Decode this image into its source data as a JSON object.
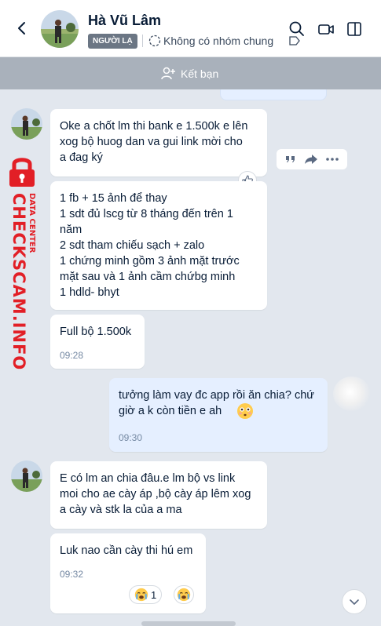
{
  "header": {
    "name": "Hà Vũ Lâm",
    "badge": "NGƯỜI LẠ",
    "group_status": "Không có nhóm chung"
  },
  "friend_bar": {
    "label": "Kết bạn"
  },
  "watermark": {
    "main": "CHECKSCAM.INFO",
    "sub": "DATA CENTER"
  },
  "messages": [
    {
      "text": "Oke a chốt lm thi bank e 1.500k e lên\nxog bộ huog dan va gui link mời cho\na đag ký"
    },
    {
      "text": "1 fb + 15 ảnh để thay\n1  sdt  đủ lscg  từ 8 tháng đến trên 1\nnăm\n2 sdt tham chiếu sạch + zalo\n1 chứng minh gồm 3 ảnh  mặt trước\nmặt sau và 1 ảnh cầm chứbg minh\n1 hdld- bhyt"
    },
    {
      "text": "Full bộ 1.500k",
      "time": "09:28"
    },
    {
      "text": "tưởng làm vay đc app rồi ăn chia? chứ\ngiờ a k còn tiền e ah",
      "time": "09:30"
    },
    {
      "text": "E có lm an chia đâu.e lm bộ vs link\nmoi cho ae cày áp ,bộ cày áp lêm xog\na cày và stk la của a ma"
    },
    {
      "text": "Luk nao cần cày thi hú em",
      "time": "09:32",
      "reaction_count": "1"
    }
  ],
  "colors": {
    "accent": "#0068ff",
    "watermark": "#e21f26",
    "my_bubble": "#e5efff"
  }
}
